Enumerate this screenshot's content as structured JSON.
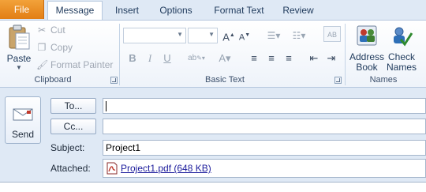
{
  "tabs": {
    "file": "File",
    "items": [
      "Message",
      "Insert",
      "Options",
      "Format Text",
      "Review"
    ],
    "active_index": 0
  },
  "clipboard": {
    "paste": "Paste",
    "cut": "Cut",
    "copy": "Copy",
    "format_painter": "Format Painter",
    "group_label": "Clipboard"
  },
  "basic_text": {
    "group_label": "Basic Text",
    "bold": "B",
    "italic": "I",
    "underline": "U"
  },
  "names": {
    "address_book": [
      "Address",
      "Book"
    ],
    "check_names": [
      "Check",
      "Names"
    ],
    "group_label": "Names"
  },
  "compose": {
    "send": "Send",
    "to_button": "To...",
    "cc_button": "Cc...",
    "to_value": "",
    "cc_value": "",
    "subject_label": "Subject:",
    "subject_value": "Project1",
    "attached_label": "Attached:",
    "attachment_name": "Project1.pdf (648 KB)"
  },
  "colors": {
    "file_tab": "#e27e14",
    "ribbon_text": "#1e395b",
    "link": "#1c1c9c"
  },
  "icons": {
    "paste": "clipboard-icon",
    "cut": "scissors-icon",
    "copy": "copy-icon",
    "format_painter": "brush-icon",
    "address_book": "address-book-icon",
    "check_names": "check-names-icon",
    "send": "envelope-icon",
    "attachment": "pdf-icon"
  }
}
